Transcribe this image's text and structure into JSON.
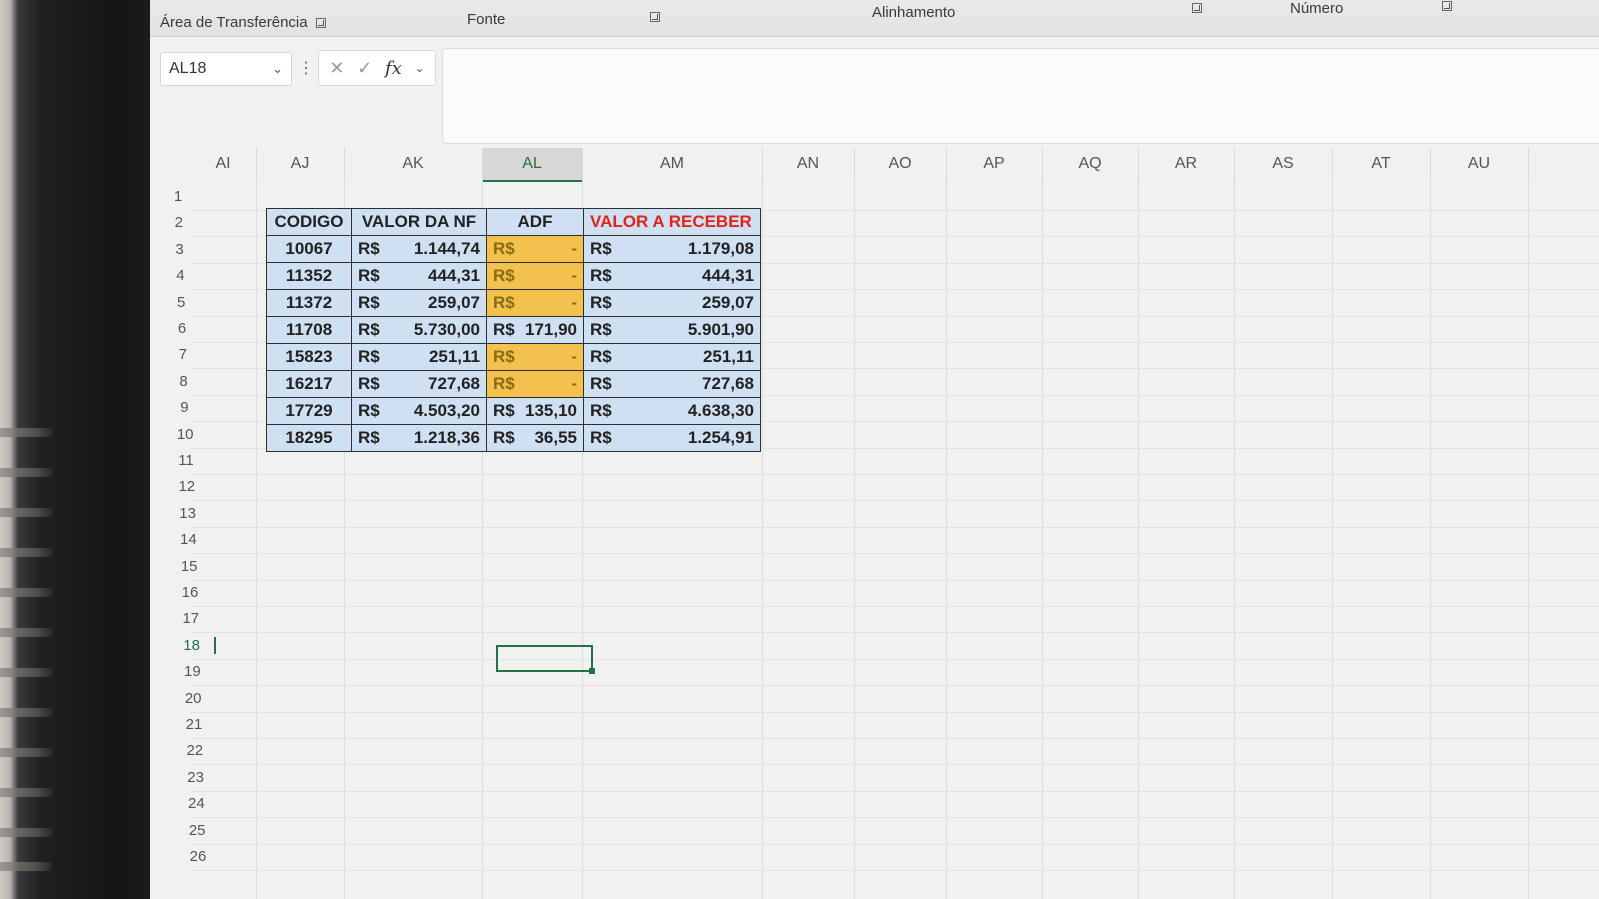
{
  "ribbon": {
    "clipboard_label": "Área de Transferência",
    "font_label": "Fonte",
    "alignment_label": "Alinhamento",
    "number_label": "Número"
  },
  "formula_bar": {
    "name_box": "AL18",
    "fx_label": "fx",
    "formula_value": ""
  },
  "columns": [
    "AI",
    "AJ",
    "AK",
    "AL",
    "AM",
    "AN",
    "AO",
    "AP",
    "AQ",
    "AR",
    "AS",
    "AT",
    "AU"
  ],
  "selected_column": "AL",
  "rows": [
    "1",
    "2",
    "3",
    "4",
    "5",
    "6",
    "7",
    "8",
    "9",
    "10",
    "11",
    "12",
    "13",
    "14",
    "15",
    "16",
    "17",
    "18",
    "19",
    "20",
    "21",
    "22",
    "23",
    "24",
    "25",
    "26"
  ],
  "selected_row": "18",
  "table": {
    "headers": {
      "codigo": "CODIGO",
      "valor_nf": "VALOR DA NF",
      "adf": "ADF",
      "valor_receber": "VALOR A RECEBER"
    },
    "rows": [
      {
        "codigo": "10067",
        "nf_cur": "R$",
        "nf_val": "1.144,74",
        "adf_cur": "R$",
        "adf_val": "-",
        "rec_cur": "R$",
        "rec_val": "1.179,08",
        "adf_highlight": true
      },
      {
        "codigo": "11352",
        "nf_cur": "R$",
        "nf_val": "444,31",
        "adf_cur": "R$",
        "adf_val": "-",
        "rec_cur": "R$",
        "rec_val": "444,31",
        "adf_highlight": true
      },
      {
        "codigo": "11372",
        "nf_cur": "R$",
        "nf_val": "259,07",
        "adf_cur": "R$",
        "adf_val": "-",
        "rec_cur": "R$",
        "rec_val": "259,07",
        "adf_highlight": true
      },
      {
        "codigo": "11708",
        "nf_cur": "R$",
        "nf_val": "5.730,00",
        "adf_cur": "R$",
        "adf_val": "171,90",
        "rec_cur": "R$",
        "rec_val": "5.901,90",
        "adf_highlight": false
      },
      {
        "codigo": "15823",
        "nf_cur": "R$",
        "nf_val": "251,11",
        "adf_cur": "R$",
        "adf_val": "-",
        "rec_cur": "R$",
        "rec_val": "251,11",
        "adf_highlight": true
      },
      {
        "codigo": "16217",
        "nf_cur": "R$",
        "nf_val": "727,68",
        "adf_cur": "R$",
        "adf_val": "-",
        "rec_cur": "R$",
        "rec_val": "727,68",
        "adf_highlight": true
      },
      {
        "codigo": "17729",
        "nf_cur": "R$",
        "nf_val": "4.503,20",
        "adf_cur": "R$",
        "adf_val": "135,10",
        "rec_cur": "R$",
        "rec_val": "4.638,30",
        "adf_highlight": false
      },
      {
        "codigo": "18295",
        "nf_cur": "R$",
        "nf_val": "1.218,36",
        "adf_cur": "R$",
        "adf_val": "36,55",
        "rec_cur": "R$",
        "rec_val": "1.254,91",
        "adf_highlight": false
      }
    ]
  },
  "colors": {
    "header_fill": "#cfe0f2",
    "highlight_fill": "#f2c14e",
    "header_red_text": "#e2231a",
    "selection_green": "#217346"
  }
}
